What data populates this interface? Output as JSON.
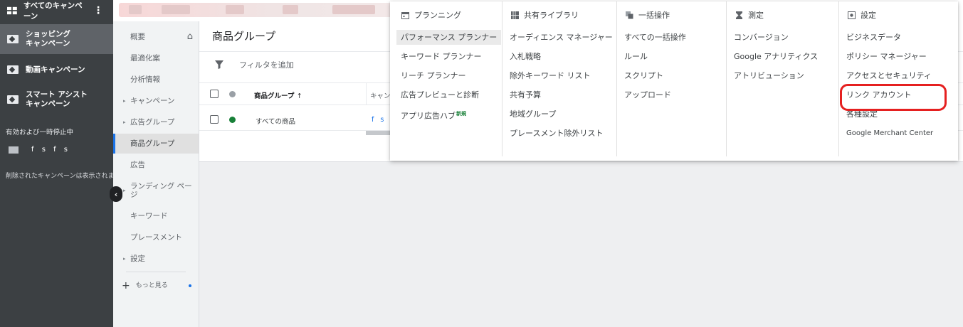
{
  "left_sidebar": {
    "all_campaigns": "すべてのキャンペーン",
    "campaigns": [
      {
        "label_line1": "ショッピング",
        "label_line2": "キャンペーン",
        "selected": true,
        "icon": "tag-icon"
      },
      {
        "label_line1": "動画キャンペーン",
        "label_line2": "",
        "selected": false,
        "icon": "video-icon"
      },
      {
        "label_line1": "スマート アシスト",
        "label_line2": "キャンペーン",
        "selected": false,
        "icon": "wand-icon"
      }
    ],
    "section_active_paused": "有効および一時停止中",
    "campaign_item": "f s f s",
    "deleted_note": "削除されたキャンペーンは表示されません"
  },
  "nav": {
    "items": [
      {
        "label": "概要",
        "caret": false,
        "home": true
      },
      {
        "label": "最適化案",
        "caret": false
      },
      {
        "label": "分析情報",
        "caret": false
      },
      {
        "label": "キャンペーン",
        "caret": true
      },
      {
        "label": "広告グループ",
        "caret": true
      },
      {
        "label": "商品グループ",
        "caret": false,
        "active": true
      },
      {
        "label": "広告",
        "caret": false
      },
      {
        "label": "ランディング ペー",
        "label2": "ジ",
        "caret": true
      },
      {
        "label": "キーワード",
        "caret": false
      },
      {
        "label": "プレースメント",
        "caret": false
      },
      {
        "label": "設定",
        "caret": true
      }
    ],
    "more": "もっと見る"
  },
  "main": {
    "title": "商品グループ",
    "filter_label": "フィルタを追加",
    "table": {
      "col_product_group": "商品グループ",
      "col_campaign": "キャン",
      "row": {
        "product_group": "すべての商品",
        "campaign": "f s f"
      }
    }
  },
  "dropdown": {
    "columns": [
      {
        "header": "プランニング",
        "icon": "calendar-icon",
        "items": [
          "パフォーマンス プランナー",
          "キーワード プランナー",
          "リーチ プランナー",
          "広告プレビューと診断",
          "アプリ広告ハブ"
        ],
        "new_badge": "新規"
      },
      {
        "header": "共有ライブラリ",
        "icon": "library-icon",
        "items": [
          "オーディエンス マネージャー",
          "入札戦略",
          "除外キーワード リスト",
          "共有予算",
          "地域グループ",
          "プレースメント除外リスト"
        ]
      },
      {
        "header": "一括操作",
        "icon": "copy-icon",
        "items": [
          "すべての一括操作",
          "ルール",
          "スクリプト",
          "アップロード"
        ]
      },
      {
        "header": "測定",
        "icon": "hourglass-icon",
        "items": [
          "コンバージョン",
          "Google アナリティクス",
          "アトリビューション"
        ]
      },
      {
        "header": "設定",
        "icon": "settings-icon",
        "items": [
          "ビジネスデータ",
          "ポリシー マネージャー",
          "アクセスとセキュリティ",
          "リンク アカウント",
          "各種設定",
          "Google Merchant Center"
        ]
      }
    ]
  },
  "colors": {
    "accent": "#1a73e8",
    "highlight_red": "#e52020",
    "status_green": "#188038",
    "sidebar_dark": "#3c4043"
  }
}
